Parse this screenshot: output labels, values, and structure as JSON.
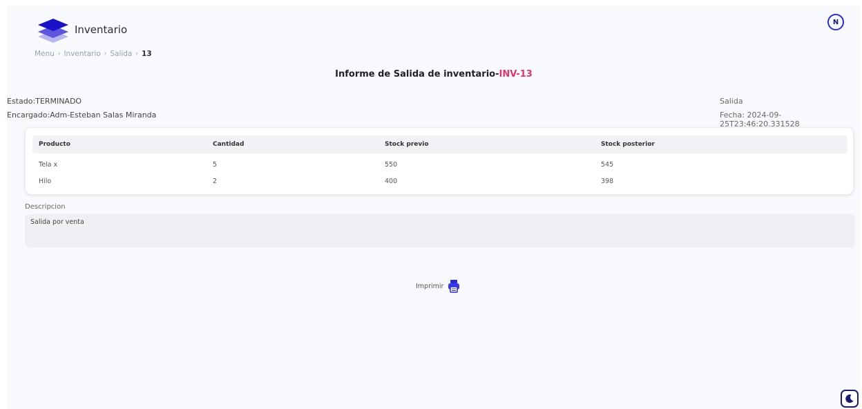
{
  "header": {
    "app_title": "Inventario",
    "avatar_initial": "N"
  },
  "breadcrumb": {
    "items": [
      "Menu",
      "Inventario",
      "Salida"
    ],
    "current": "13"
  },
  "report": {
    "title_prefix": "Informe de Salida de inventario-",
    "code": "INV-13",
    "estado": "Estado:TERMINADO",
    "encargado": "Encargado:Adm-Esteban Salas Miranda",
    "tipo": "Salida",
    "fecha": "Fecha: 2024-09-25T23:46:20.331528"
  },
  "table": {
    "headers": [
      "Producto",
      "Cantidad",
      "Stock previo",
      "Stock posterior"
    ],
    "rows": [
      [
        "Tela x",
        "5",
        "550",
        "545"
      ],
      [
        "Hilo",
        "2",
        "400",
        "398"
      ]
    ]
  },
  "descripcion": {
    "label": "Descripcion",
    "value": "Salida por venta"
  },
  "actions": {
    "print_label": "Imprimir"
  },
  "colors": {
    "accent": "#2a2ad8",
    "code_highlight": "#e8336a",
    "logo_dark": "#1a12c8",
    "logo_light": "#9c97e8"
  },
  "icons": {
    "logo": "layers-icon",
    "print": "printer-icon",
    "theme": "moon-icon"
  }
}
